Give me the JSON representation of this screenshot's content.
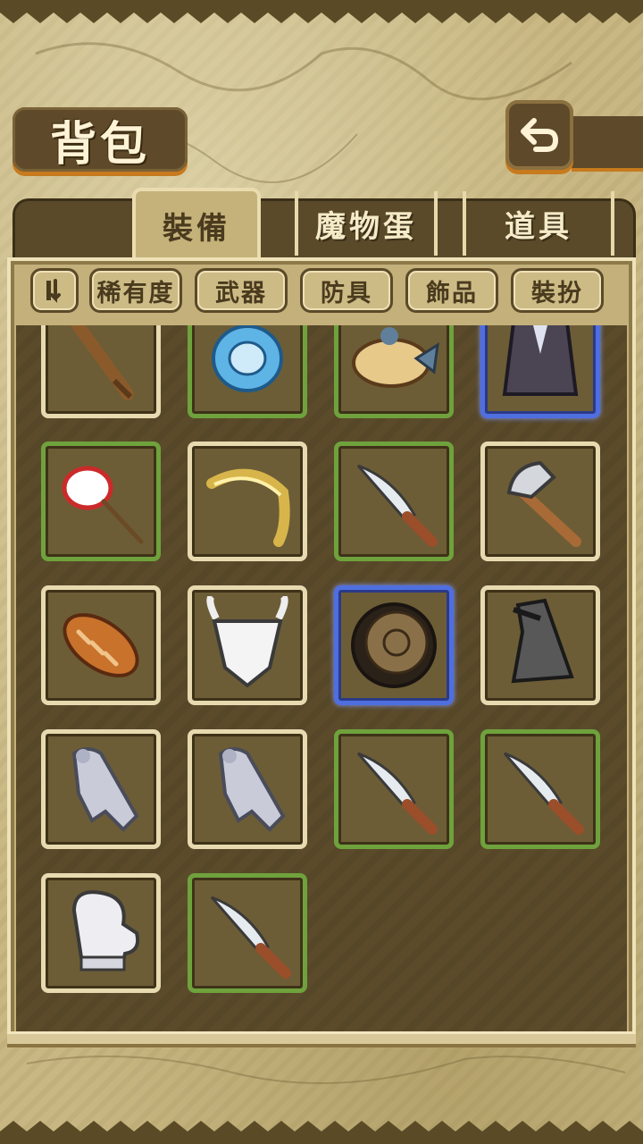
{
  "header": {
    "title": "背包",
    "back_icon": "return-arrow-icon"
  },
  "tabs": [
    {
      "label": "裝備",
      "active": true
    },
    {
      "label": "魔物蛋",
      "active": false
    },
    {
      "label": "道具",
      "active": false
    }
  ],
  "filters": {
    "sort_icon": "sort-toggle-icon",
    "items": [
      {
        "label": "稀有度"
      },
      {
        "label": "武器"
      },
      {
        "label": "防具"
      },
      {
        "label": "飾品"
      },
      {
        "label": "裝扮"
      }
    ]
  },
  "inventory": {
    "rows": [
      [
        {
          "item": "wooden-club-icon",
          "rarity": "common"
        },
        {
          "item": "blue-ring-icon",
          "rarity": "uncommon"
        },
        {
          "item": "fish-pie-icon",
          "rarity": "uncommon"
        },
        {
          "item": "suit-jacket-icon",
          "rarity": "rare"
        }
      ],
      [
        {
          "item": "bug-net-icon",
          "rarity": "uncommon"
        },
        {
          "item": "golden-feather-icon",
          "rarity": "common"
        },
        {
          "item": "knife-icon",
          "rarity": "uncommon"
        },
        {
          "item": "hammer-icon",
          "rarity": "common"
        }
      ],
      [
        {
          "item": "bread-icon",
          "rarity": "common"
        },
        {
          "item": "bone-armor-icon",
          "rarity": "common"
        },
        {
          "item": "ancient-medallion-icon",
          "rarity": "rare"
        },
        {
          "item": "grey-cloak-icon",
          "rarity": "common"
        }
      ],
      [
        {
          "item": "stone-statue-icon",
          "rarity": "common"
        },
        {
          "item": "stone-statue-icon",
          "rarity": "common"
        },
        {
          "item": "knife-icon",
          "rarity": "uncommon"
        },
        {
          "item": "knife-icon",
          "rarity": "uncommon"
        }
      ],
      [
        {
          "item": "mitten-icon",
          "rarity": "common"
        },
        {
          "item": "knife-icon",
          "rarity": "uncommon"
        }
      ]
    ]
  },
  "colors": {
    "common_border": "#e7dab0",
    "uncommon_border": "#6fa23c",
    "rare_border": "#4f6fe0",
    "panel": "#5b4b2b",
    "accent_shadow": "#c77a1e"
  }
}
